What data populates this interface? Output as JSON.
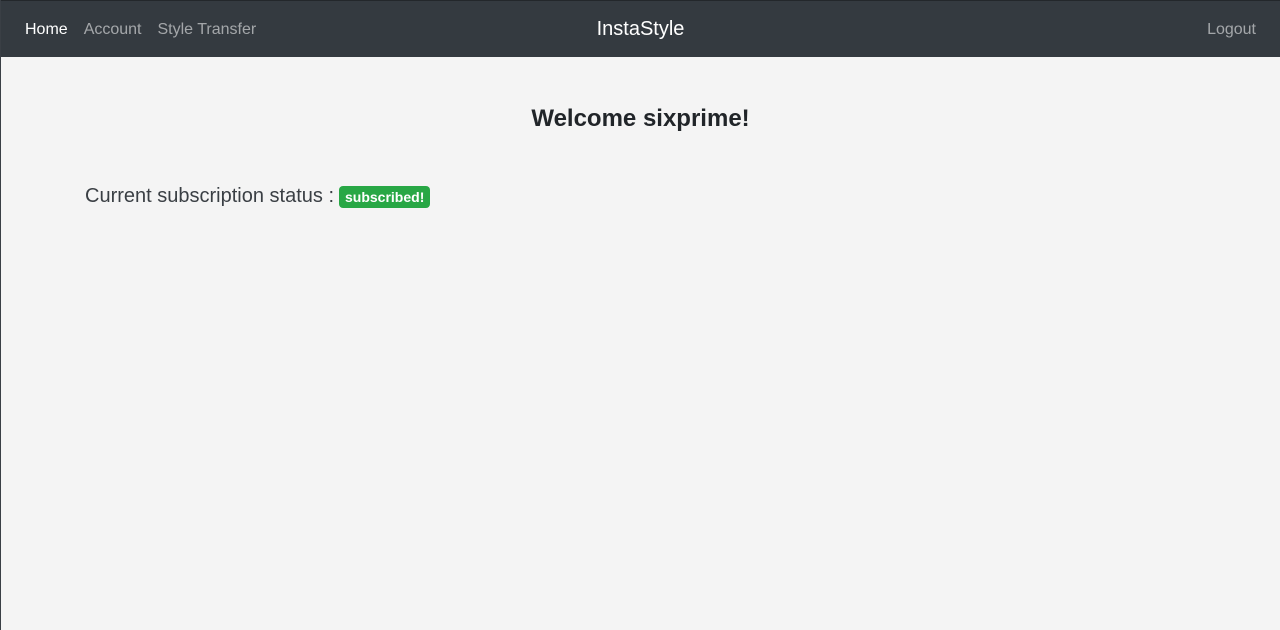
{
  "navbar": {
    "links": [
      {
        "label": "Home",
        "active": true
      },
      {
        "label": "Account",
        "active": false
      },
      {
        "label": "Style Transfer",
        "active": false
      }
    ],
    "brand": "InstaStyle",
    "logout_label": "Logout"
  },
  "main": {
    "welcome": "Welcome sixprime!",
    "status_label": "Current subscription status :",
    "status_badge": "subscribed!"
  },
  "colors": {
    "navbar_bg": "#343a40",
    "page_bg": "#f4f4f4",
    "badge_bg": "#28a745"
  }
}
